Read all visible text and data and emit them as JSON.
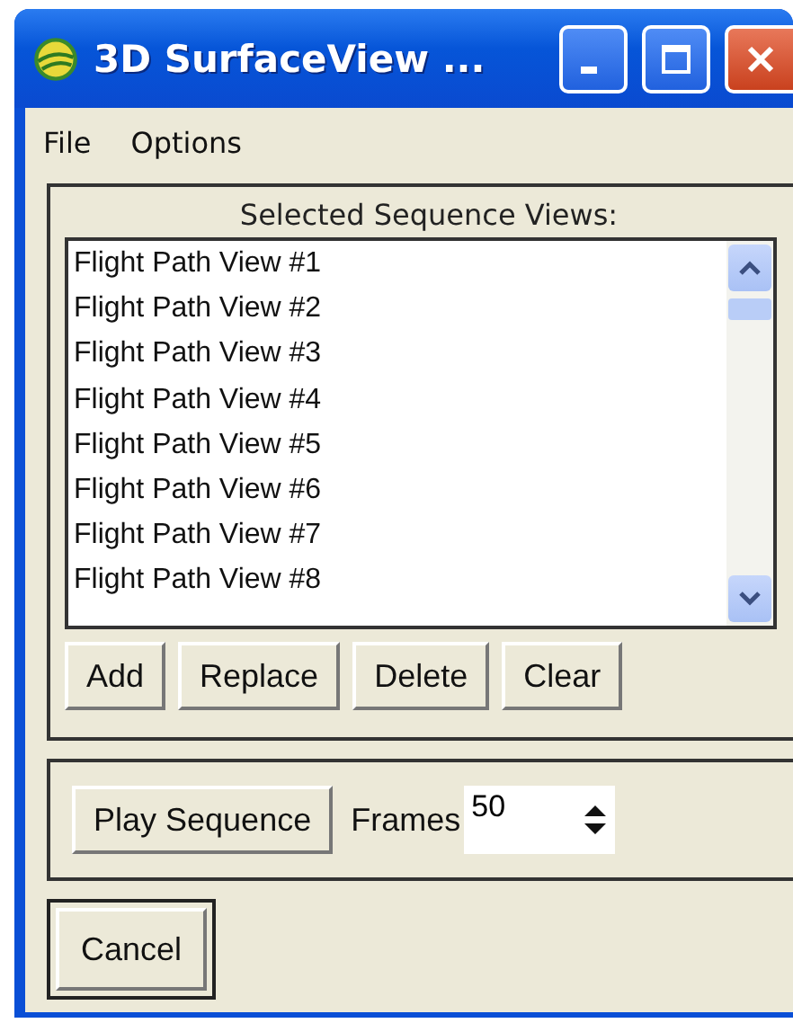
{
  "window": {
    "title": "3D SurfaceView ..."
  },
  "menu": [
    "File",
    "Options"
  ],
  "sequence_views": {
    "heading": "Selected Sequence Views:",
    "items": [
      "Flight Path View #1",
      "Flight Path View #2",
      "Flight Path View #3",
      "Flight Path View #4",
      "Flight Path View #5",
      "Flight Path View #6",
      "Flight Path View #7",
      "Flight Path View #8"
    ],
    "buttons": [
      "Add",
      "Replace",
      "Delete",
      "Clear"
    ]
  },
  "playback": {
    "button": "Play Sequence",
    "frames_label": "Frames",
    "frames_value": "50"
  },
  "cancel_button": "Cancel"
}
